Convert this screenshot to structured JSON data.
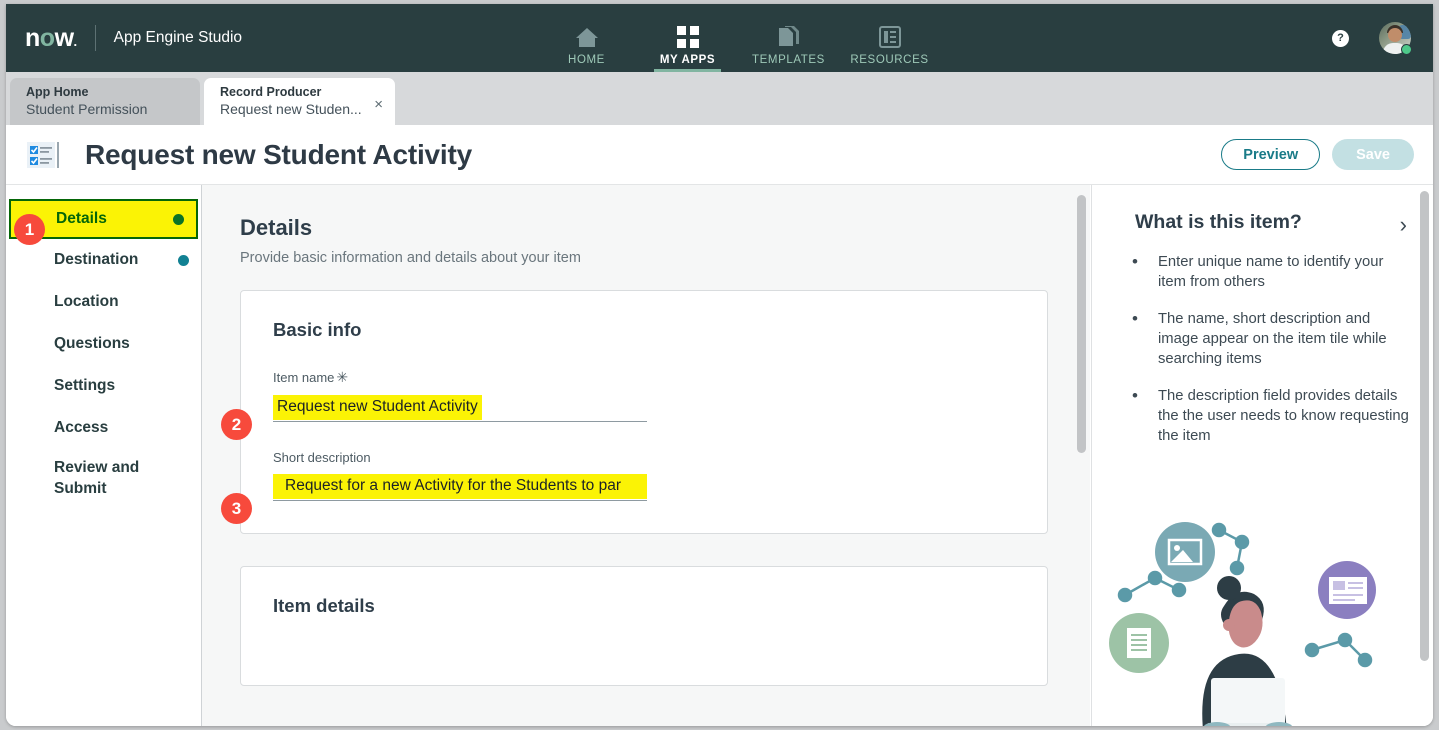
{
  "topnav": {
    "logo_text": "now",
    "app_title": "App Engine Studio",
    "items": [
      {
        "label": "HOME",
        "icon": "home-icon",
        "active": false
      },
      {
        "label": "MY APPS",
        "icon": "grid-icon",
        "active": true
      },
      {
        "label": "TEMPLATES",
        "icon": "templates-icon",
        "active": false
      },
      {
        "label": "RESOURCES",
        "icon": "resources-icon",
        "active": false
      }
    ],
    "help_label": "?",
    "accent_active": "#81b5a1",
    "bar_color": "#293e40"
  },
  "tabs": {
    "inactive": {
      "kind": "App Home",
      "name": "Student Permission"
    },
    "active": {
      "kind": "Record Producer",
      "name": "Request new Studen...",
      "close": "×"
    }
  },
  "header": {
    "title": "Request new Student Activity",
    "preview_label": "Preview",
    "save_label": "Save",
    "accent": "#1a7b88"
  },
  "sidebar": {
    "items": [
      {
        "label": "Details",
        "dot": "green",
        "highlighted": true
      },
      {
        "label": "Destination",
        "dot": "teal",
        "highlighted": false
      },
      {
        "label": "Location",
        "dot": null,
        "highlighted": false
      },
      {
        "label": "Questions",
        "dot": null,
        "highlighted": false
      },
      {
        "label": "Settings",
        "dot": null,
        "highlighted": false
      },
      {
        "label": "Access",
        "dot": null,
        "highlighted": false
      },
      {
        "label": "Review and Submit",
        "dot": null,
        "highlighted": false
      }
    ]
  },
  "main": {
    "section_title": "Details",
    "section_subtitle": "Provide basic information and details about your item",
    "basic_info": {
      "card_title": "Basic info",
      "item_name_label": "Item name",
      "item_name_required": "✳",
      "item_name_value": "Request new Student Activity",
      "short_description_label": "Short description",
      "short_description_value": "Request for a new Activity for the Students to par"
    },
    "item_details": {
      "card_title": "Item details"
    }
  },
  "right_panel": {
    "title": "What is this item?",
    "chevron": "›",
    "bullets": [
      "Enter unique name to identify your item from others",
      "The name, short description and image appear on the item tile while searching items",
      "The description field provides details the the user needs to know requesting the item"
    ]
  },
  "annotations": {
    "badges": [
      {
        "number": "1",
        "target": "sidebar-item-details"
      },
      {
        "number": "2",
        "target": "item-name-input"
      },
      {
        "number": "3",
        "target": "short-description-input"
      }
    ],
    "badge_color": "#f74a3c",
    "highlight_color": "#fbf305",
    "outline_color": "#056608"
  }
}
